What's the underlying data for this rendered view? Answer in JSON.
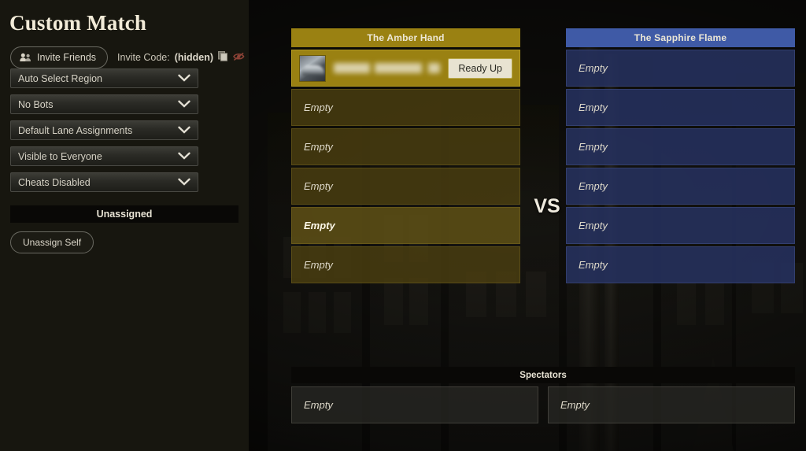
{
  "page": {
    "title": "Custom Match"
  },
  "sidebar": {
    "invite_friends_button": "Invite Friends",
    "invite_friends_icon": "friends-icon",
    "invite_code_label": "Invite Code:",
    "invite_code_value": "(hidden)",
    "copy_icon": "copy-icon",
    "hide_icon": "eye-hidden-icon",
    "dropdowns": [
      {
        "label": "Auto Select Region",
        "icon": "chevron-down-icon"
      },
      {
        "label": "No Bots",
        "icon": "chevron-down-icon"
      },
      {
        "label": "Default Lane Assignments",
        "icon": "chevron-down-icon"
      },
      {
        "label": "Visible to Everyone",
        "icon": "chevron-down-icon"
      },
      {
        "label": "Cheats Disabled",
        "icon": "chevron-down-icon"
      }
    ],
    "unassigned_header": "Unassigned",
    "unassign_self_button": "Unassign Self"
  },
  "match": {
    "vs_label": "VS",
    "teams": [
      {
        "name": "The Amber Hand",
        "color": "#9a8112",
        "slots": [
          {
            "state": "filled",
            "label": "",
            "player_name_hidden": true,
            "avatar": "player-avatar",
            "action_button": "Ready Up"
          },
          {
            "state": "empty",
            "label": "Empty"
          },
          {
            "state": "empty",
            "label": "Empty"
          },
          {
            "state": "empty",
            "label": "Empty"
          },
          {
            "state": "hovered",
            "label": "Empty"
          },
          {
            "state": "empty",
            "label": "Empty"
          }
        ]
      },
      {
        "name": "The Sapphire Flame",
        "color": "#3f5aa6",
        "slots": [
          {
            "state": "empty",
            "label": "Empty"
          },
          {
            "state": "empty",
            "label": "Empty"
          },
          {
            "state": "empty",
            "label": "Empty"
          },
          {
            "state": "empty",
            "label": "Empty"
          },
          {
            "state": "empty",
            "label": "Empty"
          },
          {
            "state": "empty",
            "label": "Empty"
          }
        ]
      }
    ]
  },
  "spectators": {
    "header": "Spectators",
    "slots": [
      {
        "label": "Empty"
      },
      {
        "label": "Empty"
      }
    ]
  }
}
